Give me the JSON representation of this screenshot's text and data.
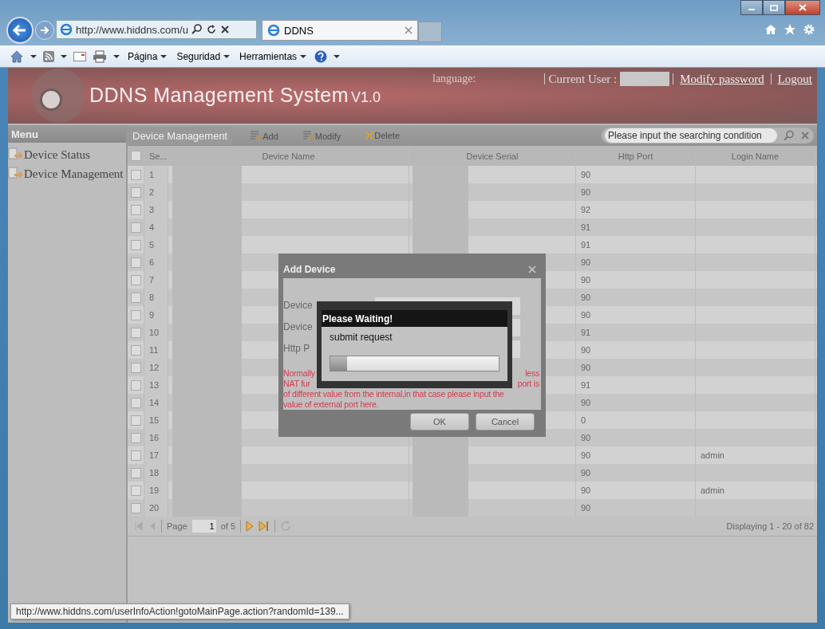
{
  "browser": {
    "address": "http://www.hiddns.com/u",
    "tab": "DDNS",
    "menus": [
      "Página",
      "Seguridad",
      "Herramientas"
    ]
  },
  "header": {
    "title": "DDNS Management System",
    "version": "V1.0",
    "language_label": "language:",
    "current_user_label": "Current User :",
    "links": [
      "Modify password",
      "Logout"
    ]
  },
  "sidebar": {
    "title": "Menu",
    "items": [
      {
        "label": "Device Status"
      },
      {
        "label": "Device Management"
      }
    ]
  },
  "panel": {
    "title": "Device Management",
    "toolbar": [
      {
        "kind": "add",
        "label": "Add"
      },
      {
        "kind": "modify",
        "label": "Modify"
      },
      {
        "kind": "delete",
        "label": "Delete"
      }
    ],
    "search": {
      "placeholder": "Please input the searching condition"
    }
  },
  "table": {
    "all_checked": false,
    "columns": [
      "Se...",
      "Device Name",
      "Device Serial",
      "Http Port",
      "Login Name"
    ],
    "rows": [
      {
        "checked": false,
        "seq": "1",
        "port": "90"
      },
      {
        "checked": false,
        "seq": "2",
        "port": "90"
      },
      {
        "checked": false,
        "seq": "3",
        "port": "92"
      },
      {
        "checked": false,
        "seq": "4",
        "port": "91"
      },
      {
        "checked": false,
        "seq": "5",
        "port": "91"
      },
      {
        "checked": false,
        "seq": "6",
        "port": "90"
      },
      {
        "checked": false,
        "seq": "7",
        "port": "90"
      },
      {
        "checked": false,
        "seq": "8",
        "port": "90"
      },
      {
        "checked": false,
        "seq": "9",
        "port": "90"
      },
      {
        "checked": false,
        "seq": "10",
        "port": "91"
      },
      {
        "checked": false,
        "seq": "11",
        "port": "90"
      },
      {
        "checked": false,
        "seq": "12",
        "port": "90"
      },
      {
        "checked": false,
        "seq": "13",
        "port": "91"
      },
      {
        "checked": false,
        "seq": "14",
        "port": "90"
      },
      {
        "checked": false,
        "seq": "15",
        "port": "0"
      },
      {
        "checked": false,
        "seq": "16",
        "port": "90"
      },
      {
        "checked": false,
        "seq": "17",
        "port": "90",
        "login": "admin"
      },
      {
        "checked": false,
        "seq": "18",
        "port": "90"
      },
      {
        "checked": false,
        "seq": "19",
        "port": "90",
        "login": "admin"
      },
      {
        "checked": false,
        "seq": "20",
        "port": "90"
      }
    ]
  },
  "pager": {
    "page_label": "Page",
    "page": "1",
    "of": "of 5",
    "display": "Displaying 1 - 20 of 82"
  },
  "add_dialog": {
    "title": "Add Device",
    "labels": [
      "Device",
      "Device",
      "Http P"
    ],
    "note_lines": [
      {
        "left": "Normally",
        "right": "less"
      },
      {
        "left": "NAT fur",
        "right": "port is"
      },
      {
        "left": "of different value from the internal,in that case please input the"
      },
      {
        "left": "value of external port here."
      }
    ],
    "buttons": [
      "OK",
      "Cancel"
    ]
  },
  "wait_dialog": {
    "title": "Please Waiting!",
    "message": "submit request",
    "level": 0.1
  },
  "status_url": "http://www.hiddns.com/userInfoAction!gotoMainPage.action?randomId=139..."
}
